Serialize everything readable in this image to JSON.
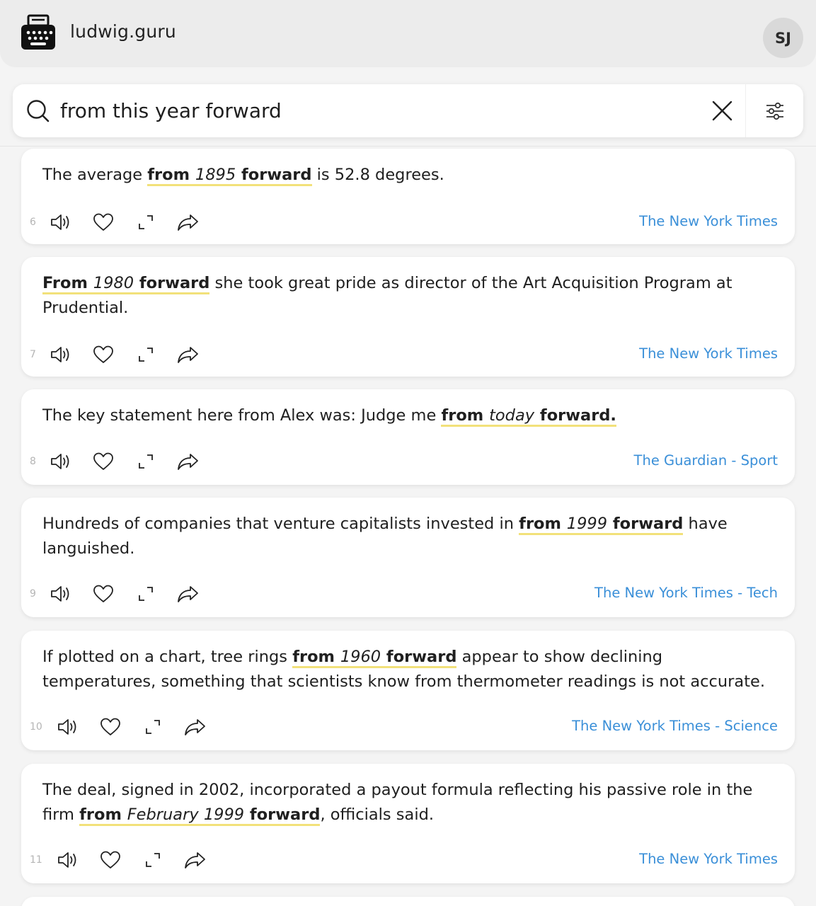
{
  "header": {
    "brand": "ludwig.guru",
    "avatar_initials": "SJ"
  },
  "search": {
    "query": "from this year forward",
    "placeholder": ""
  },
  "colors": {
    "accent_link": "#3a8fd8",
    "highlight_underline": "#f2e17a",
    "background": "#f4f4f4"
  },
  "results": [
    {
      "number": "6",
      "parts": [
        {
          "t": "The average "
        },
        {
          "t": "from ",
          "h": true
        },
        {
          "t": "1895",
          "h": true,
          "i": true
        },
        {
          "t": " forward",
          "h": true
        },
        {
          "t": " is 52.8 degrees."
        }
      ],
      "source": "The New York Times"
    },
    {
      "number": "7",
      "parts": [
        {
          "t": "From ",
          "h": true
        },
        {
          "t": "1980",
          "h": true,
          "i": true
        },
        {
          "t": " forward",
          "h": true
        },
        {
          "t": " she took great pride as director of the Art Acquisition Program at Prudential."
        }
      ],
      "source": "The New York Times"
    },
    {
      "number": "8",
      "parts": [
        {
          "t": "The key statement here from Alex was: Judge me "
        },
        {
          "t": "from ",
          "h": true
        },
        {
          "t": "today",
          "h": true,
          "i": true
        },
        {
          "t": " forward.",
          "h": true
        }
      ],
      "source": "The Guardian - Sport"
    },
    {
      "number": "9",
      "parts": [
        {
          "t": "Hundreds of companies that venture capitalists invested in "
        },
        {
          "t": "from ",
          "h": true
        },
        {
          "t": "1999",
          "h": true,
          "i": true
        },
        {
          "t": " forward",
          "h": true
        },
        {
          "t": " have languished."
        }
      ],
      "source": "The New York Times - Tech"
    },
    {
      "number": "10",
      "parts": [
        {
          "t": "If plotted on a chart, tree rings "
        },
        {
          "t": "from ",
          "h": true
        },
        {
          "t": "1960",
          "h": true,
          "i": true
        },
        {
          "t": " forward",
          "h": true
        },
        {
          "t": " appear to show declining temperatures, something that scientists know from thermometer readings is not accurate."
        }
      ],
      "source": "The New York Times - Science"
    },
    {
      "number": "11",
      "parts": [
        {
          "t": "The deal, signed in 2002, incorporated a payout formula reflecting his passive role in the firm "
        },
        {
          "t": "from ",
          "h": true
        },
        {
          "t": "February 1999",
          "h": true,
          "i": true
        },
        {
          "t": " forward",
          "h": true
        },
        {
          "t": ", officials said."
        }
      ],
      "source": "The New York Times"
    }
  ]
}
